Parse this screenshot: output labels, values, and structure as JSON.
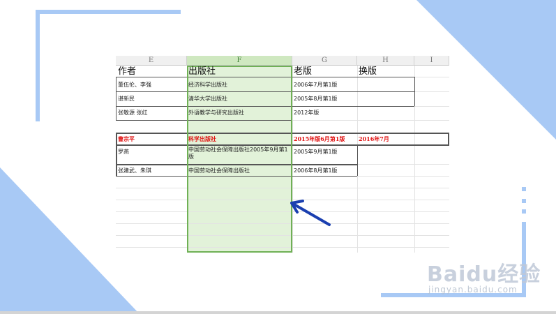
{
  "sheet": {
    "columns": [
      "E",
      "F",
      "G",
      "H",
      "I"
    ],
    "header_row": {
      "author": "作者",
      "publisher": "出版社",
      "old_edition": "老版",
      "new_edition": "换版"
    },
    "rows": [
      {
        "author": "董伍伦、李强",
        "publisher": "经济科学出版社",
        "old_edition": "2006年7月第1版",
        "new_edition": ""
      },
      {
        "author": "谌新民",
        "publisher": "清华大学出版社",
        "old_edition": "2005年8月第1版",
        "new_edition": ""
      },
      {
        "author": "张敬源 张红",
        "publisher": "外语教学与研究出版社",
        "old_edition": "2012年版",
        "new_edition": ""
      },
      {
        "author": "曹宗平",
        "publisher": "科学出版社",
        "old_edition": "2015年版6月第1版",
        "new_edition": "2016年7月"
      },
      {
        "author": "罗燕",
        "publisher": "中国劳动社会保障出版社2005年9月第1版",
        "old_edition": "2005年9月第1版",
        "new_edition": ""
      },
      {
        "author": "张建武、朱琪",
        "publisher": "中国劳动社会保障出版社",
        "old_edition": "2006年8月第1版",
        "new_edition": ""
      }
    ],
    "selected_column": "F"
  },
  "colors": {
    "accent": "#a8c9f5",
    "selection_border": "#6fb055",
    "selection_fill": "#e2f2d9",
    "highlight_text": "#e01010",
    "arrow": "#1a3fb0"
  },
  "watermark": {
    "brand": "Baidu经验",
    "url": "jingyan.baidu.com"
  }
}
